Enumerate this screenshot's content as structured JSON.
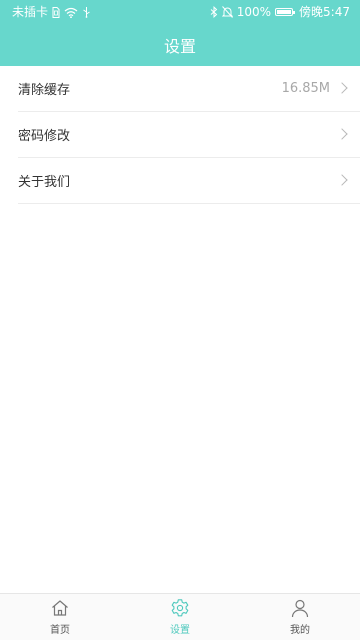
{
  "status_bar": {
    "carrier": "未插卡",
    "battery": "100%",
    "battery_level": 1.0,
    "time": "傍晚5:47"
  },
  "header": {
    "title": "设置"
  },
  "settings": [
    {
      "label": "清除缓存",
      "value": "16.85M"
    },
    {
      "label": "密码修改",
      "value": ""
    },
    {
      "label": "关于我们",
      "value": ""
    }
  ],
  "tabs": [
    {
      "label": "首页",
      "icon": "home-icon"
    },
    {
      "label": "设置",
      "icon": "gear-icon"
    },
    {
      "label": "我的",
      "icon": "user-icon"
    }
  ],
  "active_tab": "设置",
  "colors": {
    "header_bg": "#67d7cc",
    "accent": "#4fc9bd",
    "divider": "#ececec",
    "secondary_text": "#a8a8a8"
  }
}
